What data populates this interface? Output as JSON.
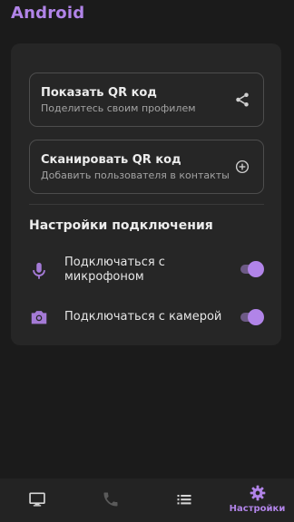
{
  "app": {
    "title": "Android"
  },
  "colors": {
    "accent": "#b184e8",
    "background": "#1b1b1b",
    "card": "#262626",
    "disabled": "#5a5a5a"
  },
  "actions": {
    "show_qr": {
      "title": "Показать QR код",
      "subtitle": "Поделитесь своим профилем",
      "icon": "share-icon"
    },
    "scan_qr": {
      "title": "Сканировать QR код",
      "subtitle": "Добавить пользователя в контакты",
      "icon": "add-circle-icon"
    }
  },
  "connection_settings": {
    "title": "Настройки подключения",
    "items": [
      {
        "label": "Подключаться с микрофоном",
        "icon": "microphone-icon",
        "enabled": true
      },
      {
        "label": "Подключаться с камерой",
        "icon": "camera-icon",
        "enabled": true
      }
    ]
  },
  "bottom_nav": {
    "items": [
      {
        "icon": "monitor-icon",
        "active": false
      },
      {
        "icon": "phone-icon",
        "active": false,
        "disabled": true
      },
      {
        "icon": "list-icon",
        "active": false
      },
      {
        "icon": "gear-icon",
        "label": "Настройки",
        "active": true
      }
    ]
  }
}
